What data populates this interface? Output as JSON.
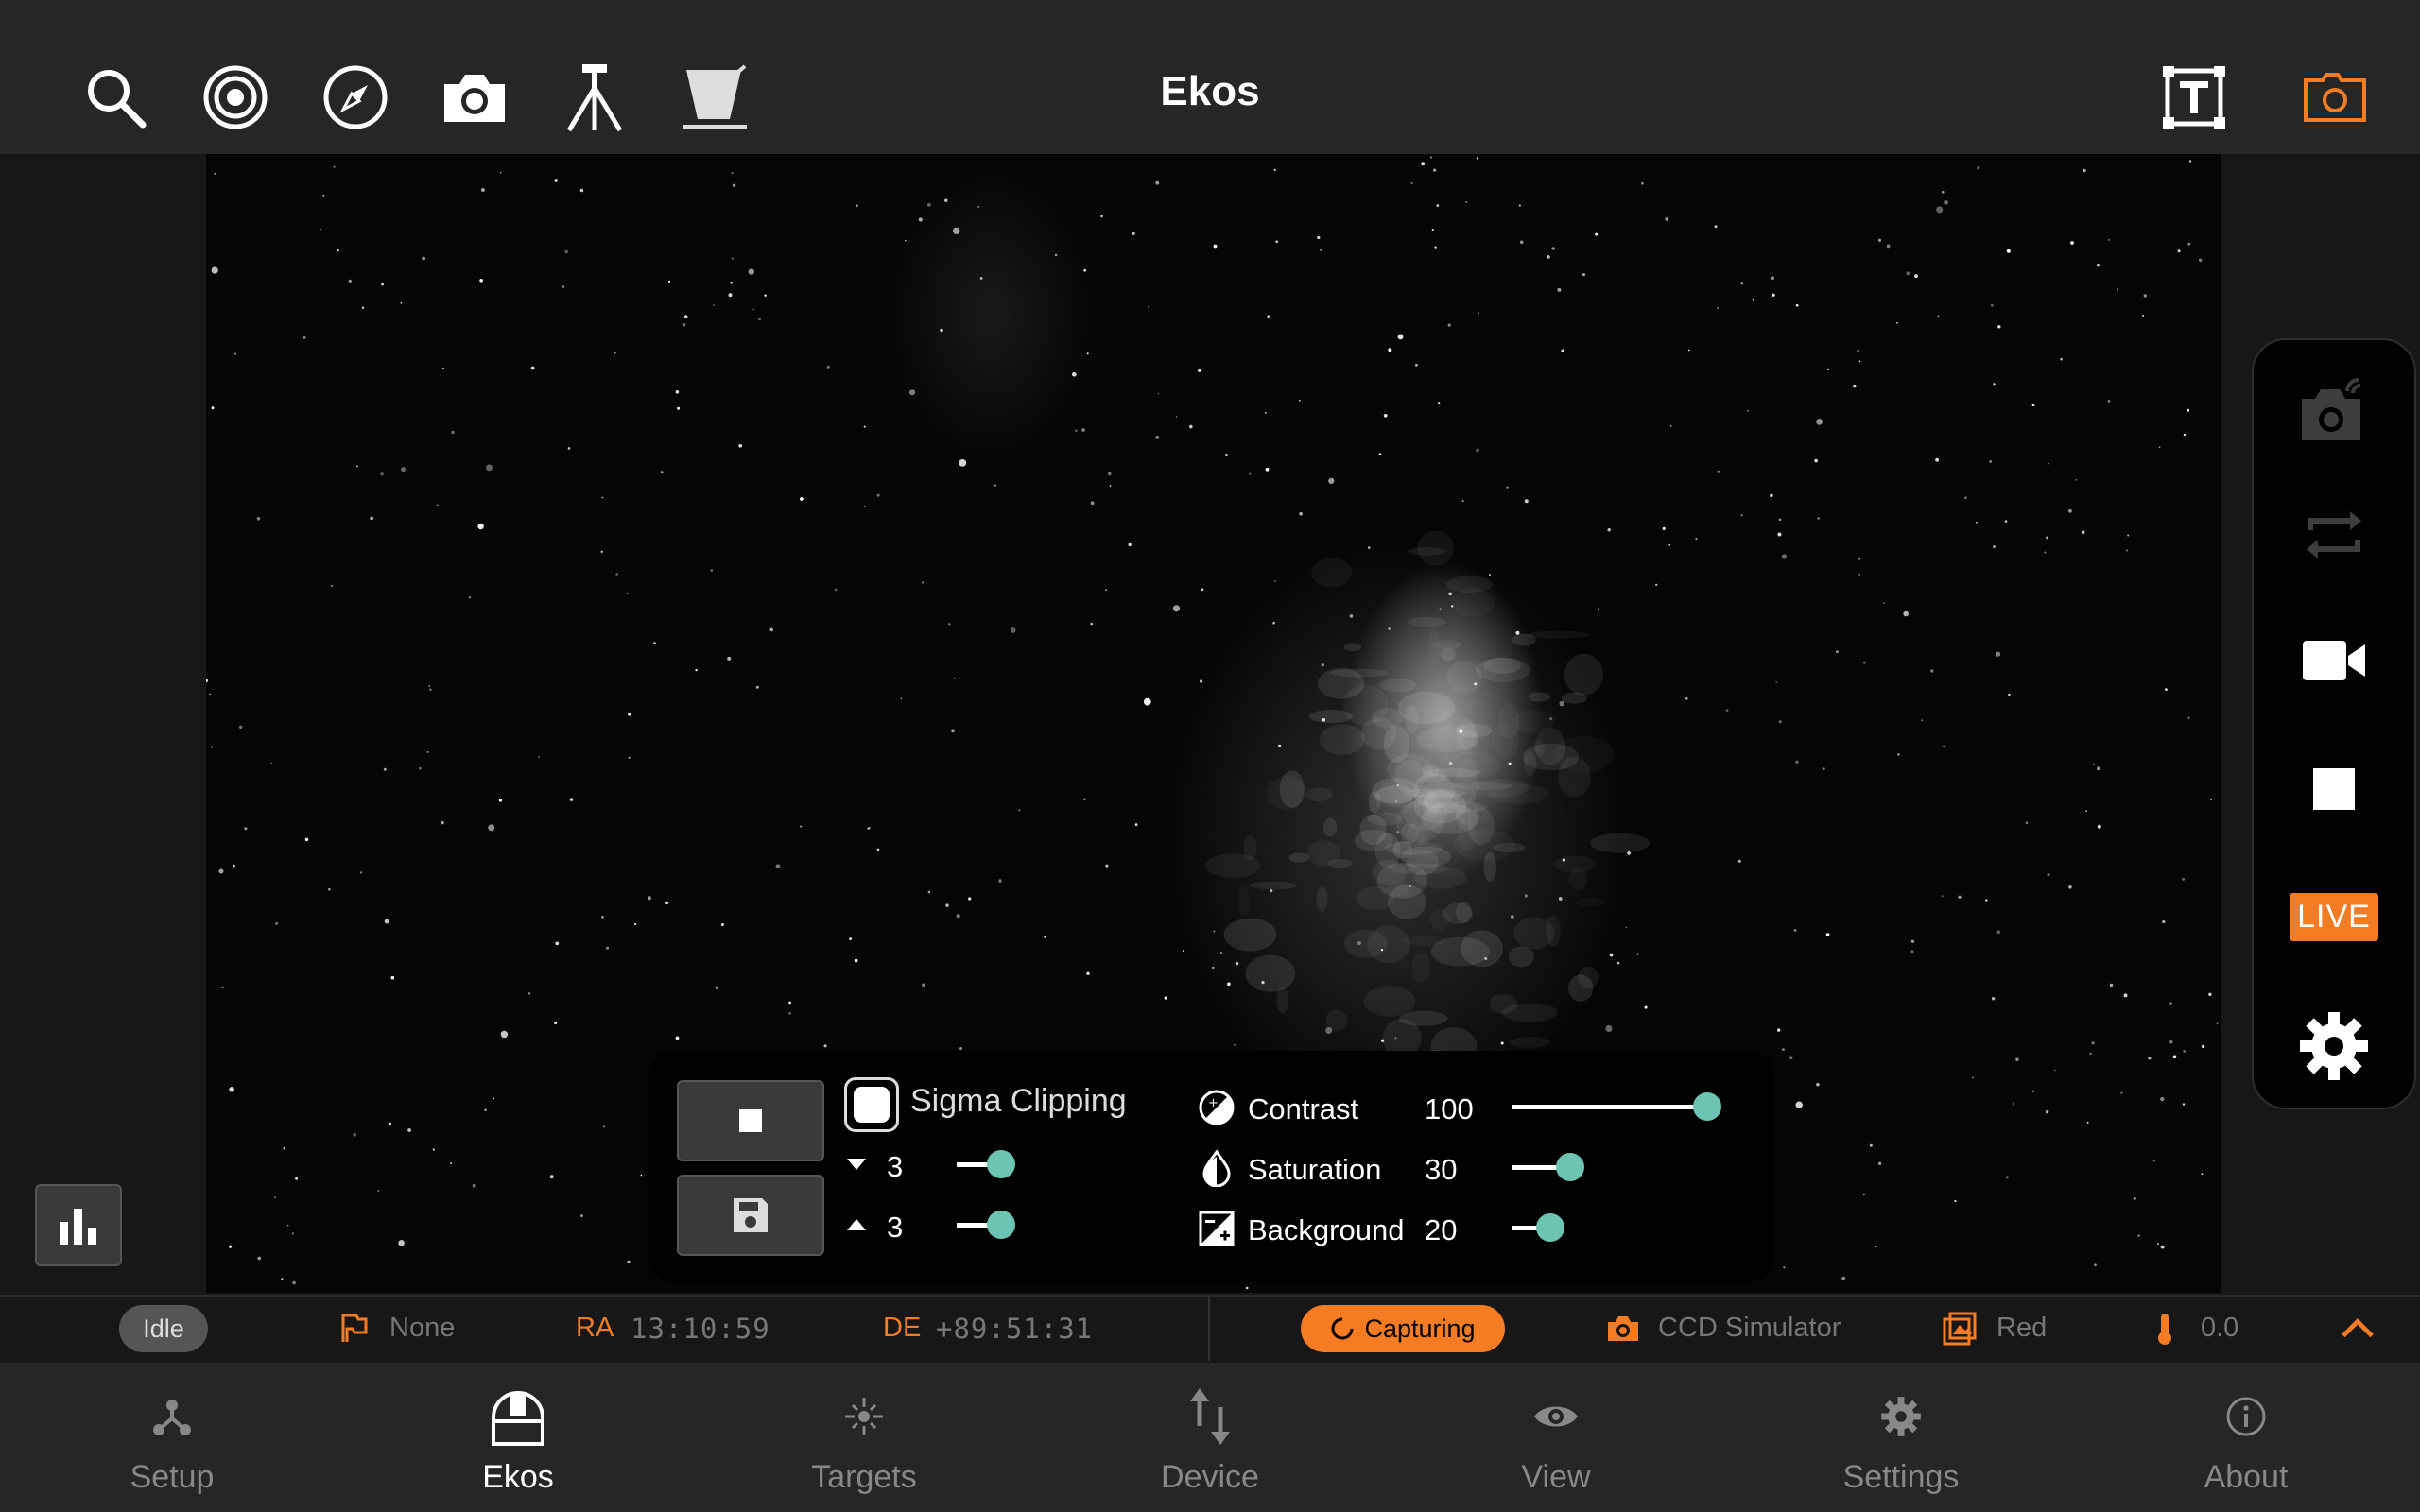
{
  "app": {
    "title": "Ekos"
  },
  "top_toolbar": {
    "left_icons": [
      "search-icon",
      "target-icon",
      "compass-icon",
      "camera-icon",
      "tripod-mount-icon",
      "flat-panel-icon"
    ],
    "right_icons": [
      "text-overlay-icon",
      "camera-frame-icon"
    ]
  },
  "colors": {
    "accent": "#f57c22",
    "slider_thumb": "#6ec4b2",
    "bar_bg": "#262626",
    "panel_bg": "#000000"
  },
  "capture_toolbar": {
    "icons": [
      "remote-camera-icon",
      "loop-icon",
      "video-icon",
      "stop-icon",
      "live-stack-icon",
      "settings-gear-icon"
    ],
    "live_label": "LIVE"
  },
  "stretch_panel": {
    "sigma_clipping": {
      "label": "Sigma Clipping",
      "checked": true
    },
    "lower_sigma": {
      "value": "3",
      "level": 0.3
    },
    "upper_sigma": {
      "value": "3",
      "level": 0.3
    },
    "contrast": {
      "label": "Contrast",
      "value": "100",
      "level": 1.0
    },
    "saturation": {
      "label": "Saturation",
      "value": "30",
      "level": 0.3
    },
    "background": {
      "label": "Background",
      "value": "20",
      "level": 0.2
    }
  },
  "status_bar": {
    "mount_state": "Idle",
    "tracking": "None",
    "ra_label": "RA",
    "ra_value": "13:10:59",
    "de_label": "DE",
    "de_value": "+89:51:31",
    "capture_state": "Capturing",
    "camera": "CCD Simulator",
    "filter": "Red",
    "temperature": "0.0"
  },
  "bottom_nav": {
    "active": "Ekos",
    "items": [
      {
        "label": "Setup",
        "icon": "setup-icon"
      },
      {
        "label": "Ekos",
        "icon": "observatory-icon"
      },
      {
        "label": "Targets",
        "icon": "targets-icon"
      },
      {
        "label": "Device",
        "icon": "device-icon"
      },
      {
        "label": "View",
        "icon": "eye-icon"
      },
      {
        "label": "Settings",
        "icon": "gear-icon"
      },
      {
        "label": "About",
        "icon": "info-icon"
      }
    ]
  }
}
